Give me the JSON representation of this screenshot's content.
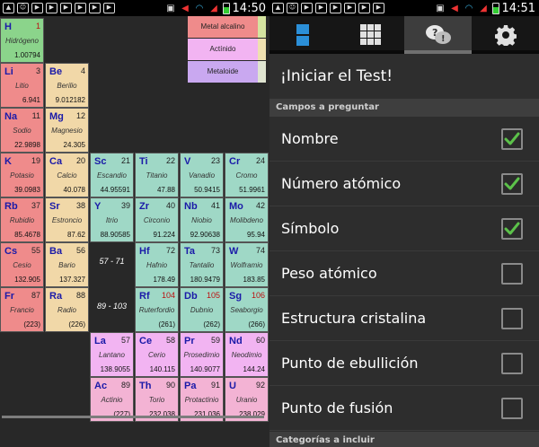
{
  "status_left": {
    "time": "14:50"
  },
  "status_right": {
    "time": "14:51"
  },
  "elements": [
    {
      "symbol": "H",
      "number": "1",
      "name": "Hidrógeno",
      "mass": "1.00794",
      "type": "nonmetal",
      "num_red": true
    },
    {
      "symbol": "Li",
      "number": "3",
      "name": "Litio",
      "mass": "6.941",
      "type": "alkali"
    },
    {
      "symbol": "Be",
      "number": "4",
      "name": "Berilio",
      "mass": "9.012182",
      "type": "alkaline"
    },
    {
      "symbol": "Na",
      "number": "11",
      "name": "Sodio",
      "mass": "22.9898",
      "type": "alkali"
    },
    {
      "symbol": "Mg",
      "number": "12",
      "name": "Magnesio",
      "mass": "24.305",
      "type": "alkaline"
    },
    {
      "symbol": "K",
      "number": "19",
      "name": "Potasio",
      "mass": "39.0983",
      "type": "alkali"
    },
    {
      "symbol": "Ca",
      "number": "20",
      "name": "Calcio",
      "mass": "40.078",
      "type": "alkaline"
    },
    {
      "symbol": "Sc",
      "number": "21",
      "name": "Escandio",
      "mass": "44.95591",
      "type": "transition"
    },
    {
      "symbol": "Ti",
      "number": "22",
      "name": "Titanio",
      "mass": "47.88",
      "type": "transition"
    },
    {
      "symbol": "V",
      "number": "23",
      "name": "Vanadio",
      "mass": "50.9415",
      "type": "transition"
    },
    {
      "symbol": "Cr",
      "number": "24",
      "name": "Cromo",
      "mass": "51.9961",
      "type": "transition"
    },
    {
      "symbol": "Rb",
      "number": "37",
      "name": "Rubidio",
      "mass": "85.4678",
      "type": "alkali"
    },
    {
      "symbol": "Sr",
      "number": "38",
      "name": "Estroncio",
      "mass": "87.62",
      "type": "alkaline"
    },
    {
      "symbol": "Y",
      "number": "39",
      "name": "Itrio",
      "mass": "88.90585",
      "type": "transition"
    },
    {
      "symbol": "Zr",
      "number": "40",
      "name": "Circonio",
      "mass": "91.224",
      "type": "transition"
    },
    {
      "symbol": "Nb",
      "number": "41",
      "name": "Niobio",
      "mass": "92.90638",
      "type": "transition"
    },
    {
      "symbol": "Mo",
      "number": "42",
      "name": "Molibdeno",
      "mass": "95.94",
      "type": "transition"
    },
    {
      "symbol": "Cs",
      "number": "55",
      "name": "Cesio",
      "mass": "132.905",
      "type": "alkali"
    },
    {
      "symbol": "Ba",
      "number": "56",
      "name": "Bario",
      "mass": "137.327",
      "type": "alkaline"
    },
    {
      "symbol": "Hf",
      "number": "72",
      "name": "Hafnio",
      "mass": "178.49",
      "type": "transition"
    },
    {
      "symbol": "Ta",
      "number": "73",
      "name": "Tantalio",
      "mass": "180.9479",
      "type": "transition"
    },
    {
      "symbol": "W",
      "number": "74",
      "name": "Wolframio",
      "mass": "183.85",
      "type": "transition"
    },
    {
      "symbol": "Fr",
      "number": "87",
      "name": "Francio",
      "mass": "(223)",
      "type": "alkali"
    },
    {
      "symbol": "Ra",
      "number": "88",
      "name": "Radio",
      "mass": "(226)",
      "type": "alkaline"
    },
    {
      "symbol": "Rf",
      "number": "104",
      "name": "Ruterfordio",
      "mass": "(261)",
      "type": "transition",
      "num_red": true
    },
    {
      "symbol": "Db",
      "number": "105",
      "name": "Dubnio",
      "mass": "(262)",
      "type": "transition",
      "num_red": true
    },
    {
      "symbol": "Sg",
      "number": "106",
      "name": "Seaborgio",
      "mass": "(266)",
      "type": "transition",
      "num_red": true
    },
    {
      "symbol": "La",
      "number": "57",
      "name": "Lantano",
      "mass": "138.9055",
      "type": "lanth"
    },
    {
      "symbol": "Ce",
      "number": "58",
      "name": "Cerio",
      "mass": "140.115",
      "type": "lanth"
    },
    {
      "symbol": "Pr",
      "number": "59",
      "name": "Prosedimio",
      "mass": "140.9077",
      "type": "lanth"
    },
    {
      "symbol": "Nd",
      "number": "60",
      "name": "Neodimio",
      "mass": "144.24",
      "type": "lanth"
    },
    {
      "symbol": "Ac",
      "number": "89",
      "name": "Actinio",
      "mass": "(227)",
      "type": "actin"
    },
    {
      "symbol": "Th",
      "number": "90",
      "name": "Torio",
      "mass": "232.038",
      "type": "actin"
    },
    {
      "symbol": "Pa",
      "number": "91",
      "name": "Protactinio",
      "mass": "231.036",
      "type": "actin"
    },
    {
      "symbol": "U",
      "number": "92",
      "name": "Uranio",
      "mass": "238.029",
      "type": "actin"
    }
  ],
  "ranges": {
    "lanthanides": "57 - 71",
    "actinides": "89 - 103"
  },
  "legend": [
    {
      "label": "Metal alcalino",
      "color": "#ef8b8b"
    },
    {
      "label": "Actínido",
      "color": "#f2b4f2"
    },
    {
      "label": "Metaloide",
      "color": "#c9a8f0"
    }
  ],
  "tabs": [
    {
      "icon": "blocks-icon"
    },
    {
      "icon": "grid-icon"
    },
    {
      "icon": "quiz-icon"
    },
    {
      "icon": "gear-icon"
    }
  ],
  "quiz": {
    "start_label": "¡Iniciar el Test!",
    "fields_header": "Campos a preguntar",
    "fields": [
      {
        "label": "Nombre",
        "checked": true
      },
      {
        "label": "Número atómico",
        "checked": true
      },
      {
        "label": "Símbolo",
        "checked": true
      },
      {
        "label": "Peso atómico",
        "checked": false
      },
      {
        "label": "Estructura cristalina",
        "checked": false
      },
      {
        "label": "Punto de ebullición",
        "checked": false
      },
      {
        "label": "Punto de fusión",
        "checked": false
      }
    ],
    "categories_header": "Categorías a incluir"
  }
}
